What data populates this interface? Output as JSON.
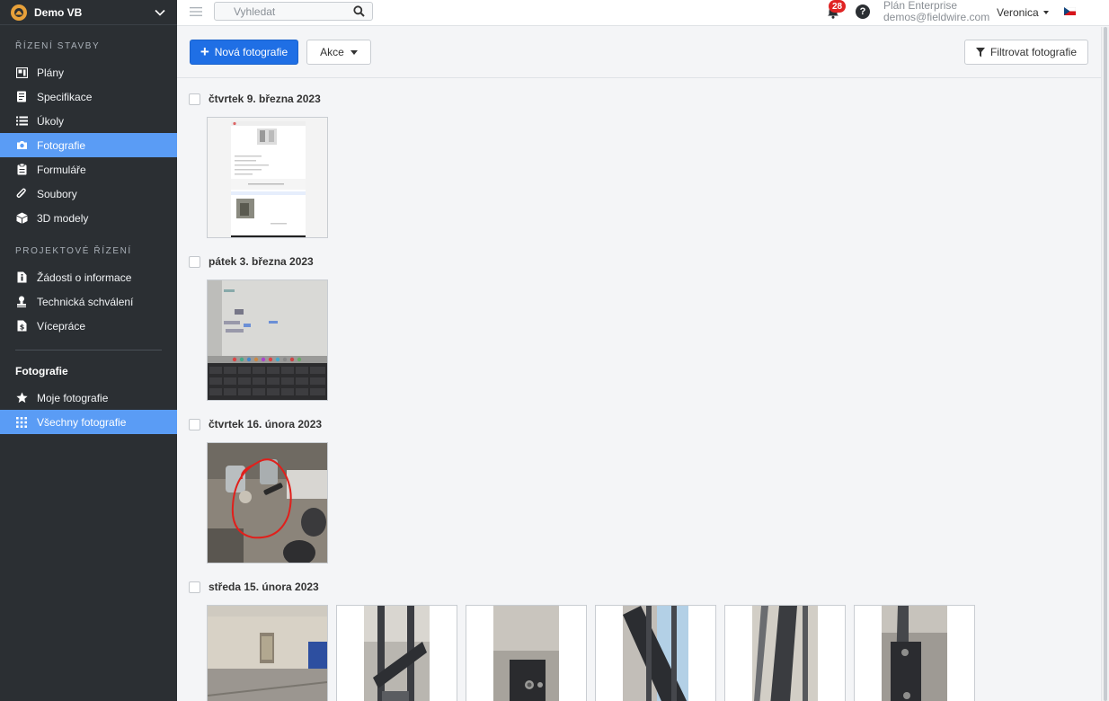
{
  "sidebar": {
    "project": "Demo VB",
    "section1": "ŘÍZENÍ STAVBY",
    "items1": [
      {
        "label": "Plány",
        "icon": "plans-icon"
      },
      {
        "label": "Specifikace",
        "icon": "specs-icon"
      },
      {
        "label": "Úkoly",
        "icon": "tasks-icon"
      },
      {
        "label": "Fotografie",
        "icon": "camera-icon",
        "active": true
      },
      {
        "label": "Formuláře",
        "icon": "forms-icon"
      },
      {
        "label": "Soubory",
        "icon": "paperclip-icon"
      },
      {
        "label": "3D modely",
        "icon": "cube-icon"
      }
    ],
    "section2": "PROJEKTOVÉ ŘÍZENÍ",
    "items2": [
      {
        "label": "Žádosti o informace",
        "icon": "info-doc-icon"
      },
      {
        "label": "Technická schválení",
        "icon": "approval-icon"
      },
      {
        "label": "Vícepráce",
        "icon": "change-order-icon"
      }
    ],
    "subhead": "Fotografie",
    "items3": [
      {
        "label": "Moje fotografie",
        "icon": "star-icon"
      },
      {
        "label": "Všechny fotografie",
        "icon": "grid-icon",
        "active": true
      }
    ]
  },
  "topbar": {
    "search_placeholder": "Vyhledat",
    "notifications": "28",
    "help": "?",
    "plan": "Plán Enterprise",
    "email": "demos@fieldwire.com",
    "user": "Veronica"
  },
  "toolbar": {
    "new_photo": "Nová fotografie",
    "actions": "Akce",
    "filter": "Filtrovat fotografie"
  },
  "groups": [
    {
      "date": "čtvrtek 9. března 2023",
      "photos": 1
    },
    {
      "date": "pátek 3. března 2023",
      "photos": 1
    },
    {
      "date": "čtvrtek 16. února 2023",
      "photos": 1
    },
    {
      "date": "středa 15. února 2023",
      "photos": 6
    }
  ],
  "colors": {
    "accent": "#1f6fe5",
    "sidebar": "#2b2f33",
    "active": "#5a9cf5",
    "badge": "#e02424"
  }
}
